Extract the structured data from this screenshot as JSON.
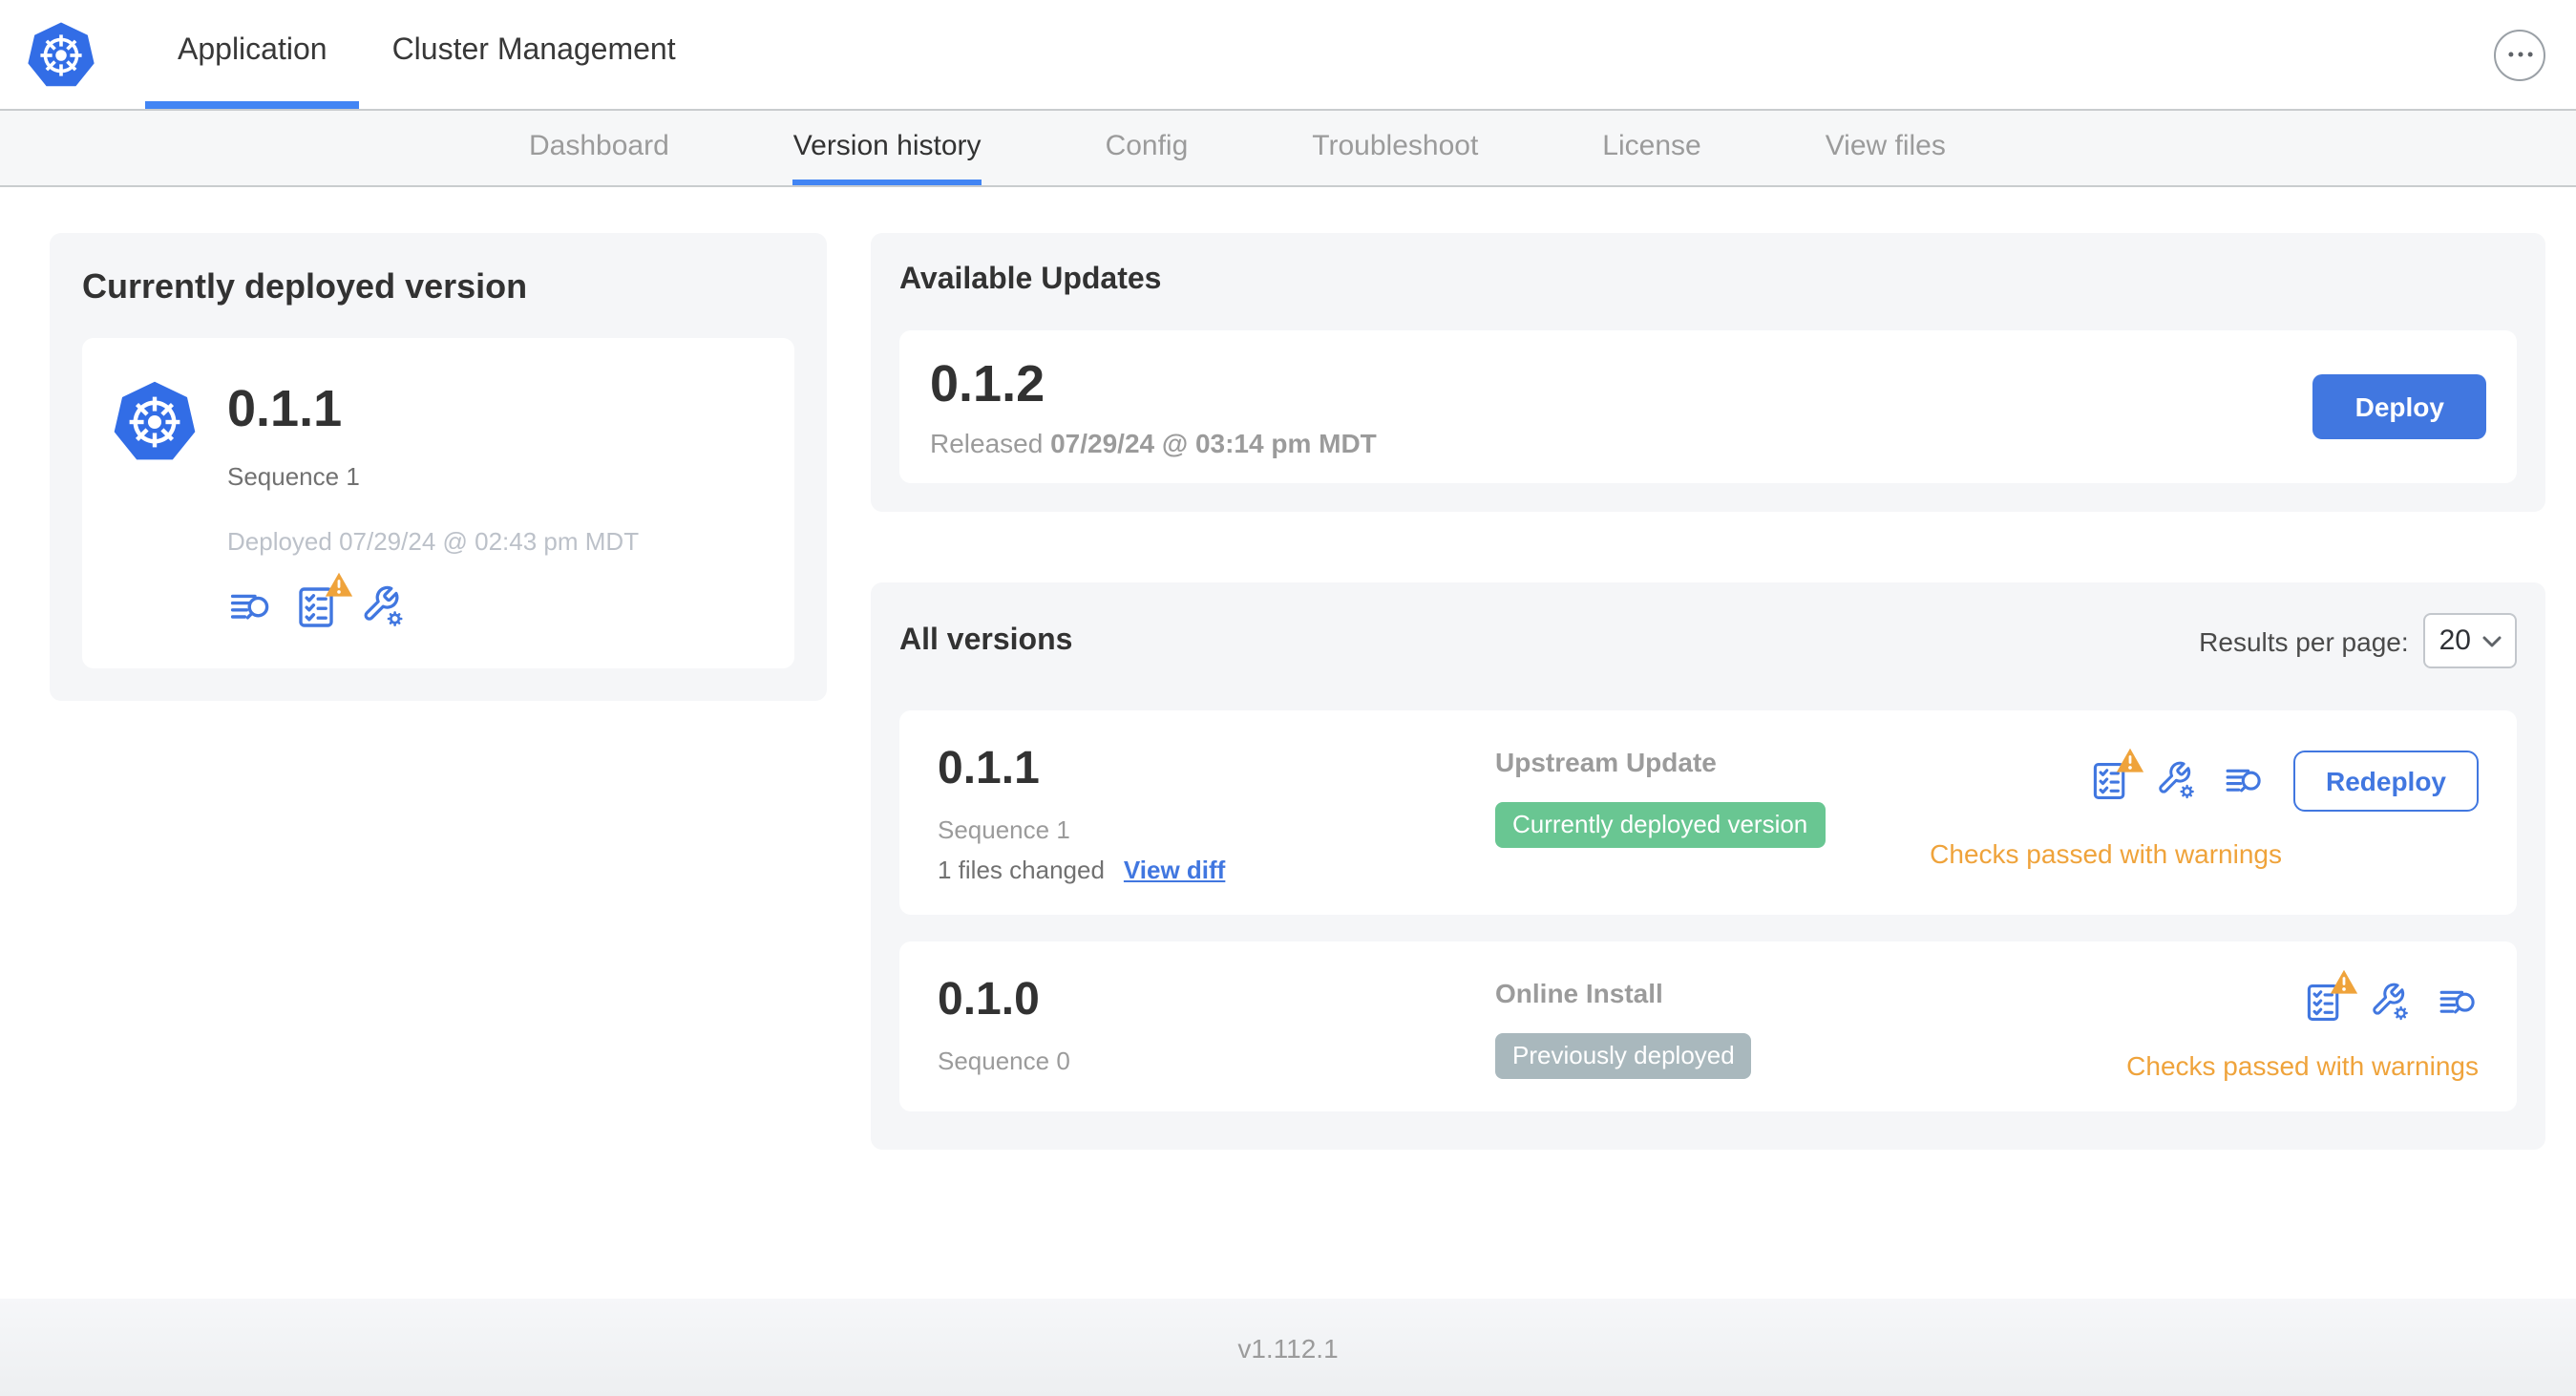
{
  "colors": {
    "primary_blue": "#4177e0",
    "active_underline": "#4285f4",
    "logo_blue": "#326de6",
    "badge_green": "#69c692",
    "badge_gray": "#a9b8bd",
    "warning_amber": "#efa33b",
    "card_bg": "#f5f6f8",
    "text_dark": "#323232",
    "text_gray": "#9b9b9b"
  },
  "icons": {
    "app_logo": "kubernetes-helm-wheel",
    "more": "ellipsis-dots",
    "release_notes": "lines-with-magnifier",
    "preflight_checks": "checklist-with-warning-triangle",
    "config_values": "wrench-with-gear",
    "select_chevron": "chevron-down"
  },
  "top_nav": {
    "tabs": [
      {
        "label": "Application"
      },
      {
        "label": "Cluster Management"
      }
    ]
  },
  "sub_nav": {
    "tabs": [
      "Dashboard",
      "Version history",
      "Config",
      "Troubleshoot",
      "License",
      "View files"
    ]
  },
  "current_version_card": {
    "title": "Currently deployed version",
    "version": "0.1.1",
    "sequence": "Sequence 1",
    "deployed": "Deployed 07/29/24 @ 02:43 pm MDT"
  },
  "available_updates": {
    "title": "Available Updates",
    "version": "0.1.2",
    "released_prefix": "Released",
    "released_date": "07/29/24 @ 03:14 pm MDT",
    "deploy_label": "Deploy"
  },
  "all_versions": {
    "title": "All versions",
    "results_label": "Results per page:",
    "results_value": "20",
    "rows": [
      {
        "version": "0.1.1",
        "sequence": "Sequence 1",
        "files_changed": "1 files changed",
        "view_diff": "View diff",
        "source": "Upstream Update",
        "badge": "Currently deployed version",
        "badge_style": "background:#69c692",
        "checks": "Checks passed with warnings",
        "action": "Redeploy"
      },
      {
        "version": "0.1.0",
        "sequence": "Sequence 0",
        "source": "Online Install",
        "badge": "Previously deployed",
        "badge_style": "background:#a9b8bd",
        "checks": "Checks passed with warnings"
      }
    ]
  },
  "footer": {
    "app_version": "v1.112.1"
  }
}
